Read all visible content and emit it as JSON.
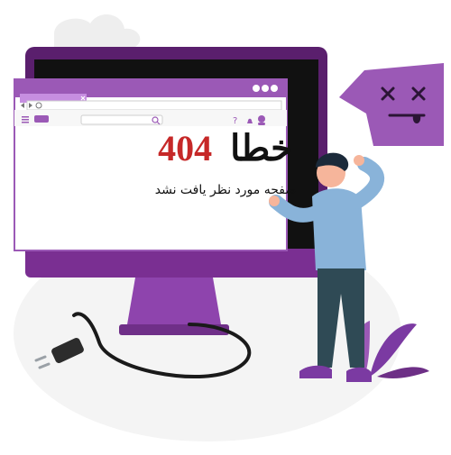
{
  "error": {
    "word": "خطا",
    "code": "404",
    "message": "صفحه مورد نظر یافت نشد"
  },
  "colors": {
    "monitor_frame": "#5a1f6d",
    "monitor_frame_highlight": "#7a2f92",
    "browser_bar": "#9b59b6",
    "browser_bar_light": "#c68ee0",
    "page_bg": "#ffffff",
    "error_code": "#c62828",
    "text_dark": "#111111",
    "stand": "#8e44ad",
    "stand_shadow": "#6f2f88",
    "desk_shadow": "#f2f2f2",
    "speech_bubble": "#9b59b6",
    "speech_bubble_dark": "#6d2f86",
    "cloud": "#eeeeee",
    "character_skin": "#f6b59b",
    "character_hair": "#1b2a3a",
    "character_shirt": "#89b3d9",
    "character_pants": "#2f4a55",
    "character_shoes": "#7b3aa2",
    "plant": "#7b3aa2"
  },
  "icons": {
    "browser_close": "close-icon",
    "browser_back": "back-arrow-icon",
    "browser_forward": "forward-arrow-icon",
    "browser_reload": "reload-icon",
    "browser_menu": "menu-icon",
    "search": "search-icon",
    "help": "question-icon",
    "notifications": "bell-icon",
    "user": "user-icon",
    "plug": "power-plug-icon",
    "dead_face": "dead-face-icon"
  }
}
